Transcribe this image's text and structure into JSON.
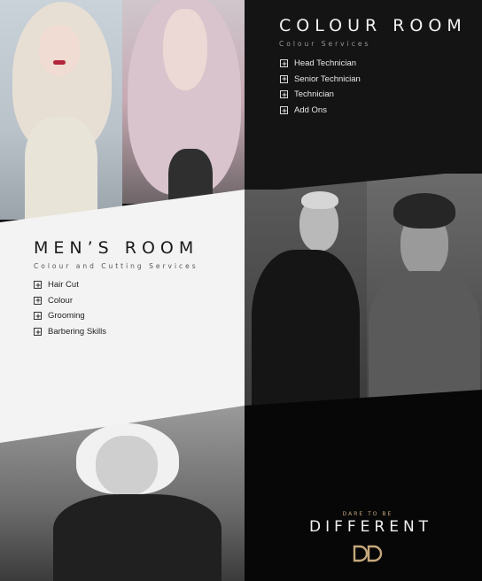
{
  "colour_room": {
    "title": "COLOUR ROOM",
    "subtitle": "Colour Services",
    "items": [
      {
        "label": "Head Technician"
      },
      {
        "label": "Senior Technician"
      },
      {
        "label": "Technician"
      },
      {
        "label": "Add Ons"
      }
    ]
  },
  "mens_room": {
    "title": "MEN’S ROOM",
    "subtitle": "Colour and Cutting Services",
    "items": [
      {
        "label": "Hair Cut"
      },
      {
        "label": "Colour"
      },
      {
        "label": "Grooming"
      },
      {
        "label": "Barbering Skills"
      }
    ]
  },
  "brand": {
    "kicker": "DARE TO BE",
    "wordmark": "DIFFERENT"
  },
  "icons": {
    "expand": "plus-box-icon",
    "logo": "dd-monogram-logo"
  },
  "colors": {
    "dark_panel": "#141414",
    "light_panel": "#f3f3f3",
    "accent_gold": "#c6a87c"
  }
}
